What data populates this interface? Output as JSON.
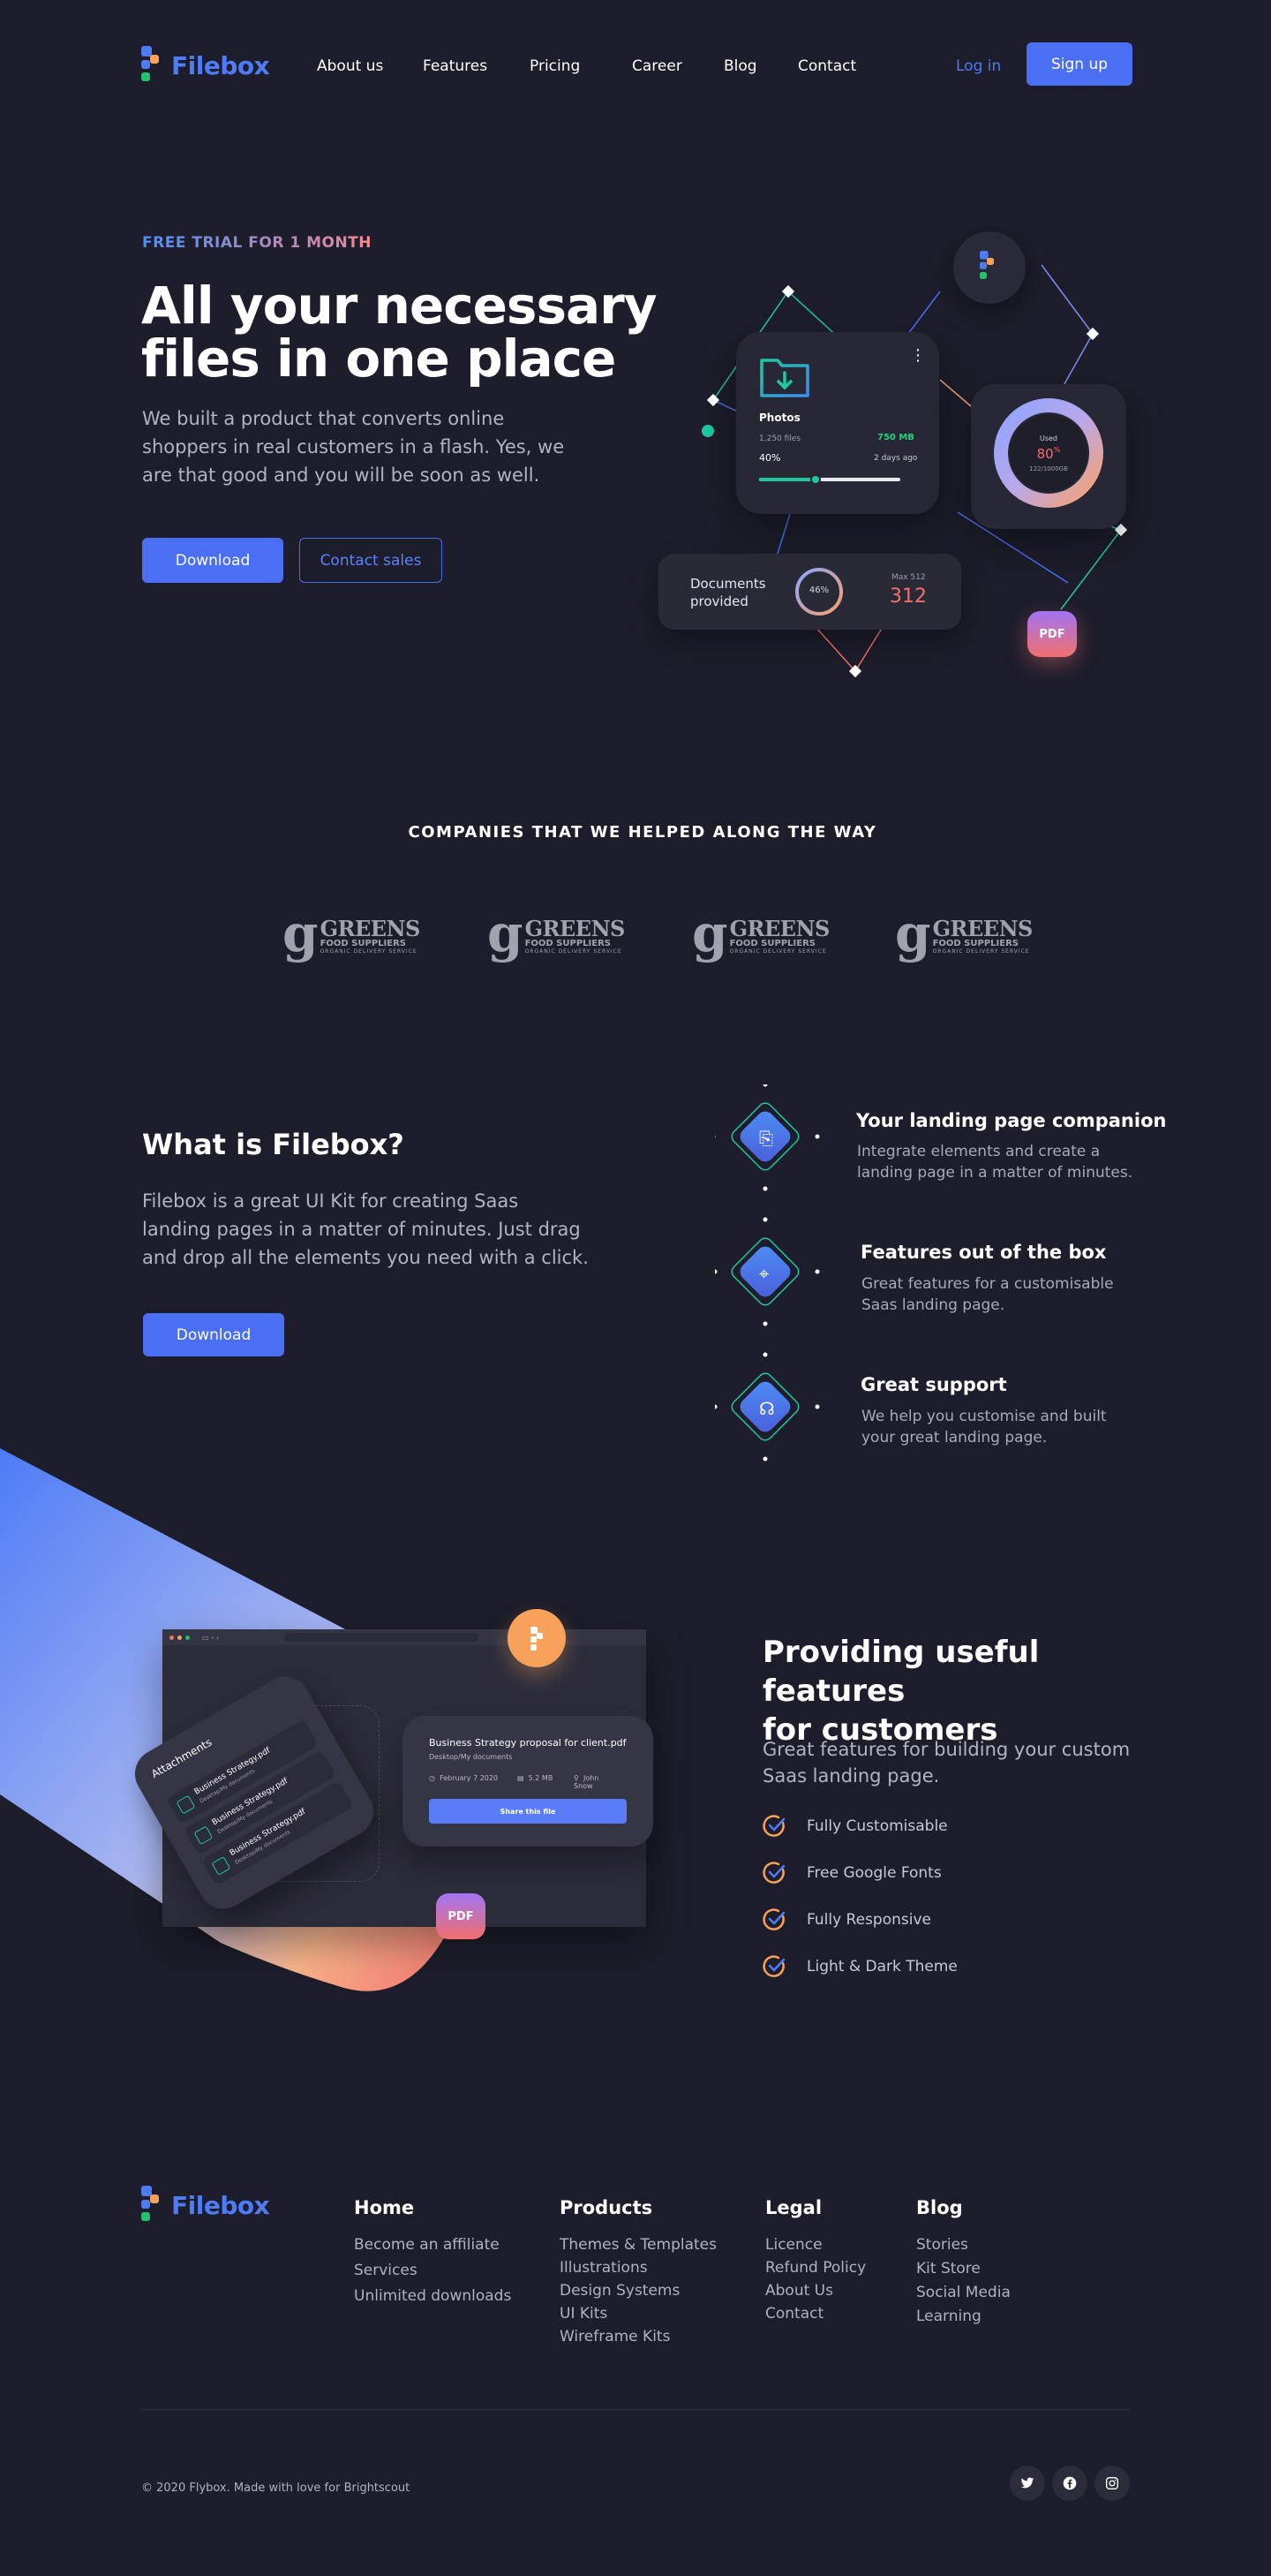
{
  "brand": {
    "name": "Filebox"
  },
  "nav": {
    "links": [
      "About us",
      "Features",
      "Pricing",
      "Career",
      "Blog",
      "Contact"
    ],
    "login": "Log in",
    "signup": "Sign up"
  },
  "hero": {
    "eyebrow": "FREE TRIAL FOR 1 MONTH",
    "title_line1": "All your necessary",
    "title_line2": "files in one place",
    "subtitle": "We built a product that converts online shoppers in real customers in a flash. Yes, we are that good and you will be soon as well.",
    "download": "Download",
    "contact": "Contact sales",
    "card_photos": {
      "title": "Photos",
      "files": "1,250 files",
      "size": "750 MB",
      "percent": "40%",
      "time": "2 days ago",
      "progress": 0.4
    },
    "card_usage": {
      "label": "Used",
      "percent": "80",
      "unit": "%",
      "detail": "122/1000GB"
    },
    "card_docs": {
      "label_line1": "Documents",
      "label_line2": "provided",
      "percent": "46%",
      "max_label": "Max 512",
      "count": "312"
    },
    "pdf_badge": "PDF"
  },
  "companies": {
    "caption": "COMPANIES THAT WE HELPED ALONG THE WAY",
    "logos": [
      {
        "letter": "g",
        "name": "GREENS",
        "sub": "FOOD SUPPLIERS",
        "mini": "ORGANIC DELIVERY SERVICE"
      },
      {
        "letter": "g",
        "name": "GREENS",
        "sub": "FOOD SUPPLIERS",
        "mini": "ORGANIC DELIVERY SERVICE"
      },
      {
        "letter": "g",
        "name": "GREENS",
        "sub": "FOOD SUPPLIERS",
        "mini": "ORGANIC DELIVERY SERVICE"
      },
      {
        "letter": "g",
        "name": "GREENS",
        "sub": "FOOD SUPPLIERS",
        "mini": "ORGANIC DELIVERY SERVICE"
      }
    ]
  },
  "about": {
    "title": "What is Filebox?",
    "text": "Filebox is a great UI Kit for creating Saas landing pages in a matter of minutes. Just drag and drop all the elements you need with a click.",
    "download": "Download",
    "features": [
      {
        "title": "Your landing page companion",
        "desc": "Integrate elements and create a landing page in a matter of minutes."
      },
      {
        "title": "Features out of the box",
        "desc": "Great features for a customisable Saas landing page."
      },
      {
        "title": "Great support",
        "desc": "We help you customise and built your great landing page."
      }
    ]
  },
  "useful": {
    "title_line1": "Providing useful features",
    "title_line2": "for customers",
    "subtitle": "Great features for building your custom Saas landing page.",
    "checks": [
      "Fully Customisable",
      "Free Google Fonts",
      "Fully Responsive",
      "Light & Dark Theme"
    ],
    "mock": {
      "attachments": "Attachments",
      "rows": [
        "Business Strategy.pdf",
        "Business Strategy.pdf",
        "Business Strategy.pdf"
      ],
      "row_sub": "Desktop/My documents",
      "file_title": "Business Strategy proposal for client.pdf",
      "file_path": "Desktop/My documents",
      "file_date": "February 7 2020",
      "file_size": "5.2 MB",
      "file_author": "John Snow",
      "share": "Share this file",
      "pdf": "PDF"
    }
  },
  "footer": {
    "brand": "Filebox",
    "columns": [
      {
        "title": "Home",
        "links": [
          "Become an affiliate",
          "Services",
          "Unlimited downloads"
        ]
      },
      {
        "title": "Products",
        "links": [
          "Themes & Templates",
          "Illustrations",
          "Design Systems",
          "UI Kits",
          "Wireframe Kits"
        ]
      },
      {
        "title": "Legal",
        "links": [
          "Licence",
          "Refund Policy",
          "About Us",
          "Contact"
        ]
      },
      {
        "title": "Blog",
        "links": [
          "Stories",
          "Kit Store",
          "Social Media",
          "Learning"
        ]
      }
    ],
    "copyright": "© 2020 Flybox. Made with love for Brightscout",
    "social_icons": [
      "twitter-icon",
      "facebook-icon",
      "instagram-icon"
    ]
  },
  "colors": {
    "bg": "#1d1d2b",
    "accent": "#4a6ff3",
    "brand": "#4e7cf6",
    "teal": "#1fc8a0",
    "coral": "#f2706e",
    "orange": "#f7a15b"
  }
}
